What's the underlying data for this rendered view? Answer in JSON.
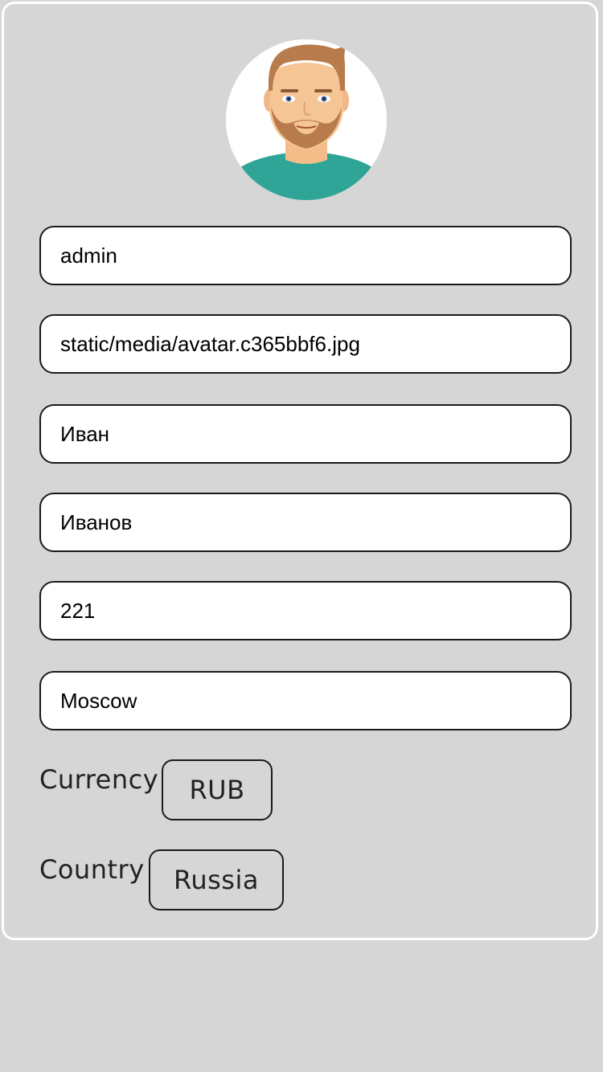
{
  "profile": {
    "avatar_icon": "user-avatar-bearded-man",
    "fields": [
      {
        "name": "username-field",
        "value": "admin"
      },
      {
        "name": "avatar-path-field",
        "value": "static/media/avatar.c365bbf6.jpg"
      },
      {
        "name": "first-name-field",
        "value": "Иван"
      },
      {
        "name": "last-name-field",
        "value": "Иванов"
      },
      {
        "name": "number-field",
        "value": "221"
      },
      {
        "name": "city-field",
        "value": "Moscow"
      }
    ],
    "currency": {
      "label": "Currency",
      "value": "RUB"
    },
    "country": {
      "label": "Country",
      "value": "Russia"
    }
  },
  "colors": {
    "page_background": "#d6d6d6",
    "card_border": "#ffffff",
    "field_background": "#ffffff",
    "field_border": "#1a1a1a",
    "shirt": "#2ea597",
    "hair": "#b87b4b",
    "skin": "#f5c595"
  }
}
